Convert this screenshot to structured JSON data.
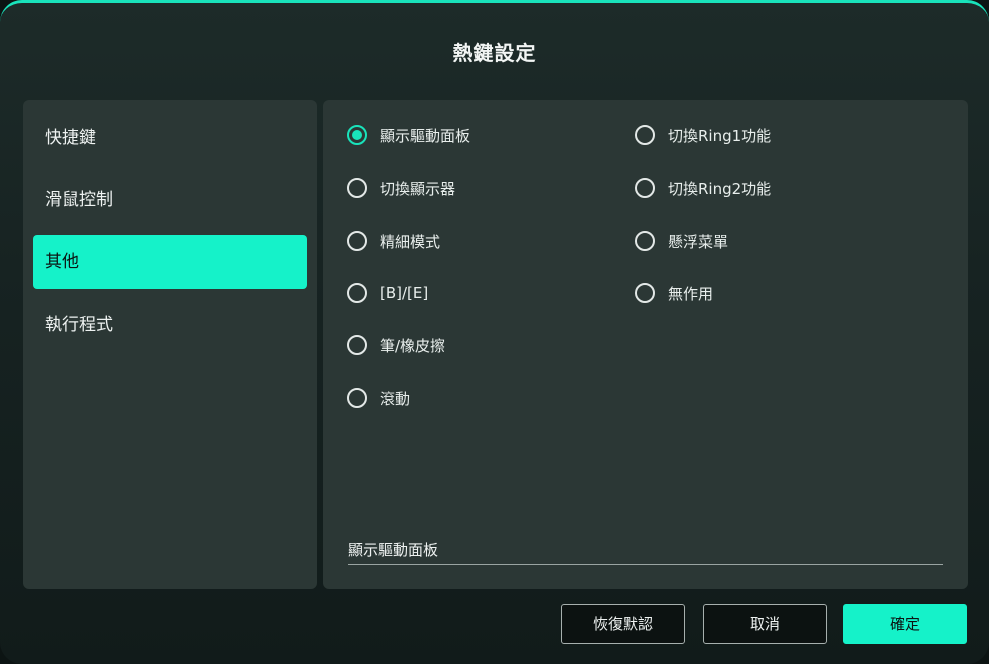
{
  "dialog": {
    "title": "熱鍵設定"
  },
  "sidebar": {
    "items": [
      {
        "label": "快捷鍵",
        "active": false
      },
      {
        "label": "滑鼠控制",
        "active": false
      },
      {
        "label": "其他",
        "active": true
      },
      {
        "label": "執行程式",
        "active": false
      }
    ]
  },
  "options": {
    "left": [
      {
        "label": "顯示驅動面板",
        "checked": true
      },
      {
        "label": "切換顯示器",
        "checked": false
      },
      {
        "label": "精細模式",
        "checked": false
      },
      {
        "label": "[B]/[E]",
        "checked": false
      },
      {
        "label": "筆/橡皮擦",
        "checked": false
      },
      {
        "label": "滾動",
        "checked": false
      }
    ],
    "right": [
      {
        "label": "切換Ring1功能",
        "checked": false
      },
      {
        "label": "切換Ring2功能",
        "checked": false
      },
      {
        "label": "懸浮菜單",
        "checked": false
      },
      {
        "label": "無作用",
        "checked": false
      }
    ]
  },
  "selected_value": "顯示驅動面板",
  "buttons": {
    "restore_default": "恢復默認",
    "cancel": "取消",
    "confirm": "確定"
  },
  "colors": {
    "accent": "#15f2c9",
    "panel": "#2b3735",
    "background": "#111b1a"
  }
}
